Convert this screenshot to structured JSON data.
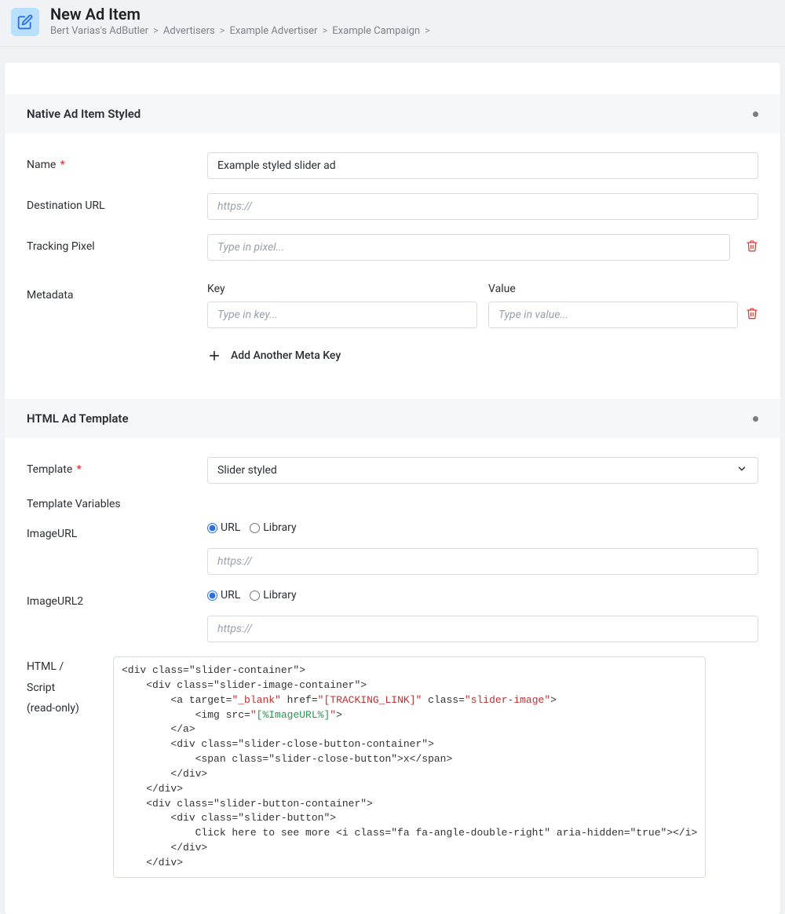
{
  "header": {
    "title": "New Ad Item",
    "breadcrumb": [
      "Bert Varias's AdButler",
      "Advertisers",
      "Example Advertiser",
      "Example Campaign"
    ]
  },
  "section1": {
    "title": "Native Ad Item Styled",
    "name_label": "Name",
    "name_value": "Example styled slider ad",
    "dest_label": "Destination URL",
    "dest_placeholder": "https://",
    "pixel_label": "Tracking Pixel",
    "pixel_placeholder": "Type in pixel...",
    "meta_label": "Metadata",
    "meta_key_header": "Key",
    "meta_value_header": "Value",
    "meta_key_placeholder": "Type in key...",
    "meta_value_placeholder": "Type in value...",
    "add_meta_label": "Add Another Meta Key"
  },
  "section2": {
    "title": "HTML Ad Template",
    "template_label": "Template",
    "template_value": "Slider styled",
    "tvars_label": "Template Variables",
    "imgurl_label": "ImageURL",
    "imgurl2_label": "ImageURL2",
    "radio_url": "URL",
    "radio_library": "Library",
    "https_placeholder": "https://",
    "code_label_l1": "HTML /",
    "code_label_l2": "Script",
    "code_label_l3": "(read-only)",
    "code": {
      "l1": "<div class=\"slider-container\">",
      "l2": "    <div class=\"slider-image-container\">",
      "l3a": "        <a target=",
      "l3b": "\"_blank\"",
      "l3c": " href=",
      "l3d": "\"[TRACKING_LINK]\"",
      "l3e": " class=",
      "l3f": "\"slider-image\"",
      "l3g": ">",
      "l4a": "            <img src=",
      "l4b": "\"",
      "l4c": "[%ImageURL%]",
      "l4d": "\"",
      "l4e": ">",
      "l5": "        </a>",
      "l6": "        <div class=\"slider-close-button-container\">",
      "l7": "            <span class=\"slider-close-button\">x</span>",
      "l8": "        </div>",
      "l9": "    </div>",
      "l10": "    <div class=\"slider-button-container\">",
      "l11": "        <div class=\"slider-button\">",
      "l12": "            Click here to see more <i class=\"fa fa-angle-double-right\" aria-hidden=\"true\"></i>",
      "l13": "        </div>",
      "l14": "    </div>"
    }
  }
}
